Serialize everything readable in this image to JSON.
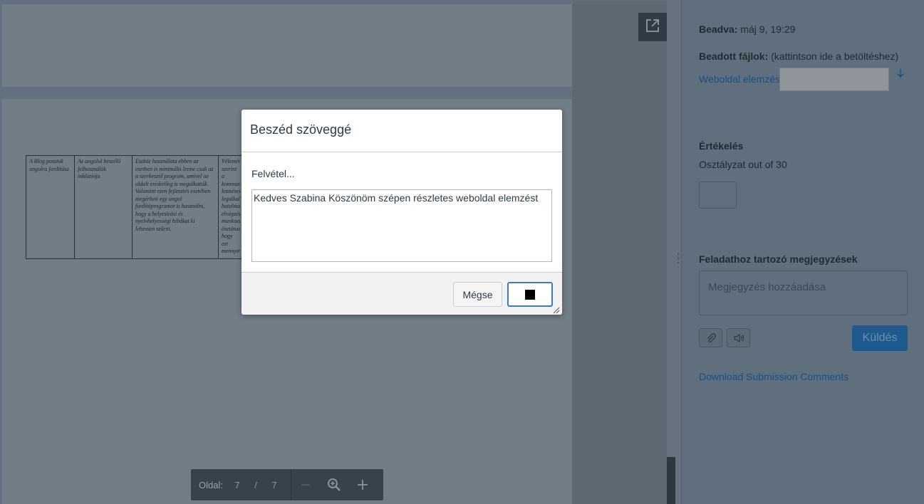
{
  "pdf_viewer": {
    "doc_table": {
      "cells": [
        "A Blog posztok angolra fordítása",
        "Az angolul beszélő felhasználók inklúziója",
        "Eszköz használata ebben az esetben is minimális lenne csak az a szerkesztő program, amivel az oldalt eredetileg is megalkották. Valamint ezen fejlesztés esetében megérheti egy angol fordítóprogramot is használni, hogy a helyesírási és nyelvhelyességi hibákat ki lehessen szűrni.",
        "Véleményem szerint a kommunikációs lennének legalkalmasabbak hatalmas elvégzésére munkaerő- ösztönzése hogy ezt mennyire"
      ]
    },
    "toolbar": {
      "page_label": "Oldal:",
      "current_page": "7",
      "separator": "/",
      "total_pages": "7"
    },
    "icons": {
      "popout": "external-link-icon",
      "zoom_out": "minus-icon",
      "zoom": "zoom-in-icon",
      "zoom_in": "plus-icon"
    }
  },
  "sidebar": {
    "submitted_label": "Beadva:",
    "submitted_value": "máj 9, 19:29",
    "files_label": "Beadott fájlok:",
    "files_hint": "(kattintson ide a betöltéshez)",
    "file_link": "Weboldal elemzés",
    "grading_title": "Értékelés",
    "grade_caption": "Osztályzat out of 30",
    "comments_title": "Feladathoz tartozó megjegyzések",
    "comment_placeholder": "Megjegyzés hozzáadása",
    "send_label": "Küldés",
    "download_link": "Download Submission Comments"
  },
  "modal": {
    "title": "Beszéd szöveggé",
    "status": "Felvétel...",
    "transcript": "Kedves Szabina Köszönöm szépen részletes weboldal elemzést",
    "cancel_label": "Mégse"
  },
  "colors": {
    "accent": "#3e7bb8",
    "link": "#16518c",
    "send_button": "#1f5a8e"
  }
}
